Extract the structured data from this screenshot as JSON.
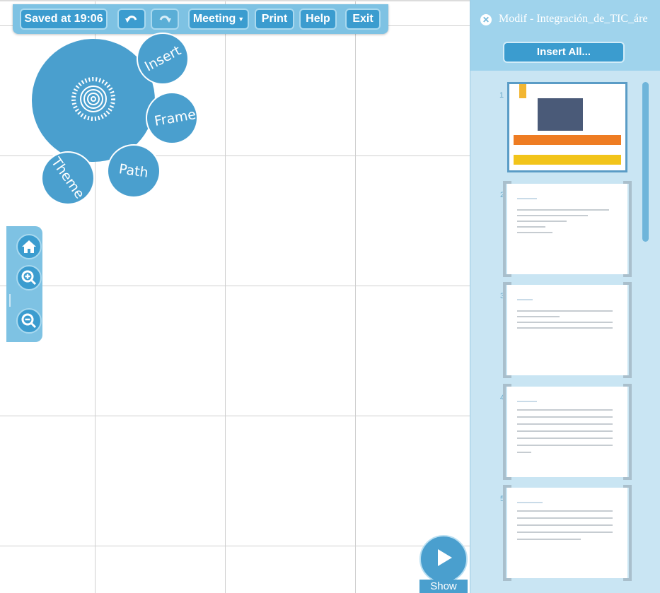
{
  "toolbar": {
    "saved_label": "Saved at 19:06",
    "meeting_label": "Meeting",
    "print_label": "Print",
    "help_label": "Help",
    "exit_label": "Exit"
  },
  "bubble_menu": {
    "insert": "Insert",
    "frame": "Frame",
    "path": "Path",
    "theme": "Theme"
  },
  "show_label": "Show",
  "panel": {
    "title": "Modif - Integración_de_TIC_áre",
    "insert_all_label": "Insert All...",
    "slides": [
      {
        "number": "1"
      },
      {
        "number": "2"
      },
      {
        "number": "3"
      },
      {
        "number": "4"
      },
      {
        "number": "5"
      }
    ]
  },
  "colors": {
    "accent": "#4a9fce",
    "toolbar": "#7ec2e3",
    "panel": "#c9e5f3"
  }
}
